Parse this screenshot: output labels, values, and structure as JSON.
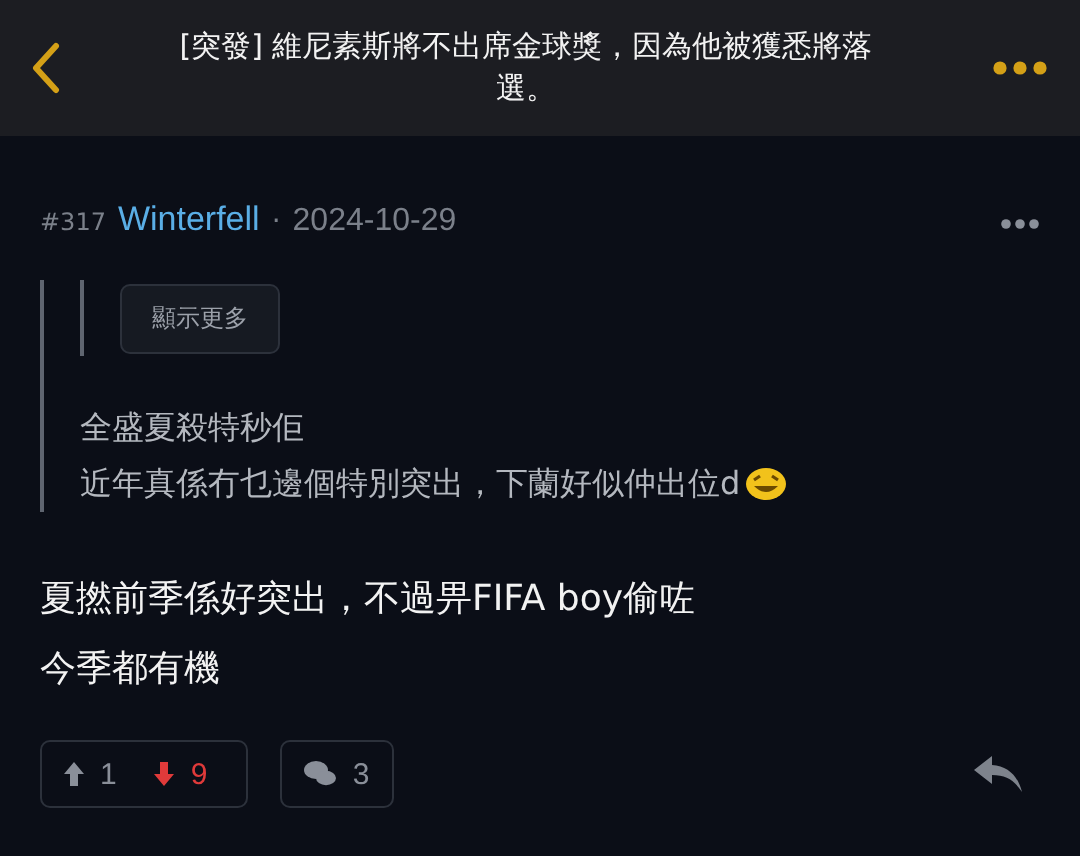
{
  "header": {
    "title": "[突發] 維尼素斯將不出席金球獎，因為他被獲悉將落選。"
  },
  "post": {
    "number": "#317",
    "author": "Winterfell",
    "separator": "·",
    "date": "2024-10-29",
    "quote": {
      "show_more": "顯示更多",
      "lines": [
        "全盛夏殺特秒佢",
        "近年真係冇乜邊個特別突出，下蘭好似仲出位d"
      ]
    },
    "body": [
      "夏撚前季係好突出，不過畀FIFA boy偷咗",
      "今季都有機"
    ],
    "votes": [
      {
        "kind": "up",
        "count": "1"
      },
      {
        "kind": "down",
        "count": "9"
      }
    ],
    "comments": "3"
  }
}
